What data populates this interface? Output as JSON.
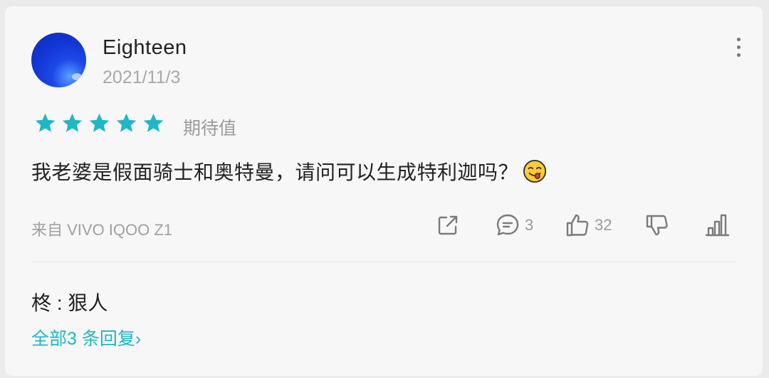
{
  "user": {
    "name": "Eighteen",
    "date": "2021/11/3"
  },
  "rating": {
    "stars": 5,
    "max": 5,
    "label": "期待值",
    "color": "#1fb7c4"
  },
  "comment": {
    "text": "我老婆是假面骑士和奥特曼，请问可以生成特利迦吗？",
    "emoji": "yum-face-emoji"
  },
  "device": "来自 VIVO IQOO Z1",
  "actions": {
    "share_icon": "share-icon",
    "comment_icon": "comment-icon",
    "comment_count": "3",
    "like_icon": "thumbs-up-icon",
    "like_count": "32",
    "dislike_icon": "thumbs-down-icon",
    "stats_icon": "bar-chart-icon"
  },
  "reply": {
    "text": "柊 : 狠人"
  },
  "all_replies_label": "全部3 条回复",
  "colors": {
    "accent": "#1fb7c4",
    "icon_gray": "#7a7a7a",
    "meta_gray": "#a0a0a0"
  }
}
